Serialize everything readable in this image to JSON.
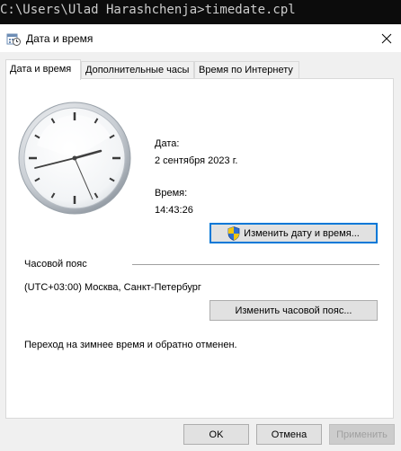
{
  "console": {
    "text": "C:\\Users\\Ulad Harashchenja>timedate.cpl"
  },
  "window": {
    "title": "Дата и время",
    "icon": "clock-calendar-icon",
    "close_icon": "close-icon"
  },
  "tabs": [
    {
      "label": "Дата и время",
      "active": true
    },
    {
      "label": "Дополнительные часы",
      "active": false
    },
    {
      "label": "Время по Интернету",
      "active": false
    }
  ],
  "datetime": {
    "date_label": "Дата:",
    "date_value": "2 сентября 2023 г.",
    "time_label": "Время:",
    "time_value": "14:43:26",
    "change_button": "Изменить дату и время..."
  },
  "timezone": {
    "section_label": "Часовой пояс",
    "value": "(UTC+03:00) Москва, Санкт-Петербург",
    "change_button": "Изменить часовой пояс..."
  },
  "dst_note": "Переход на зимнее время и обратно отменен.",
  "footer": {
    "ok": "OK",
    "cancel": "Отмена",
    "apply": "Применить"
  },
  "colors": {
    "accent": "#0078d7",
    "console_bg": "#0c0c0c",
    "shield_blue": "#2f6fd1",
    "shield_yellow": "#f2c511"
  }
}
